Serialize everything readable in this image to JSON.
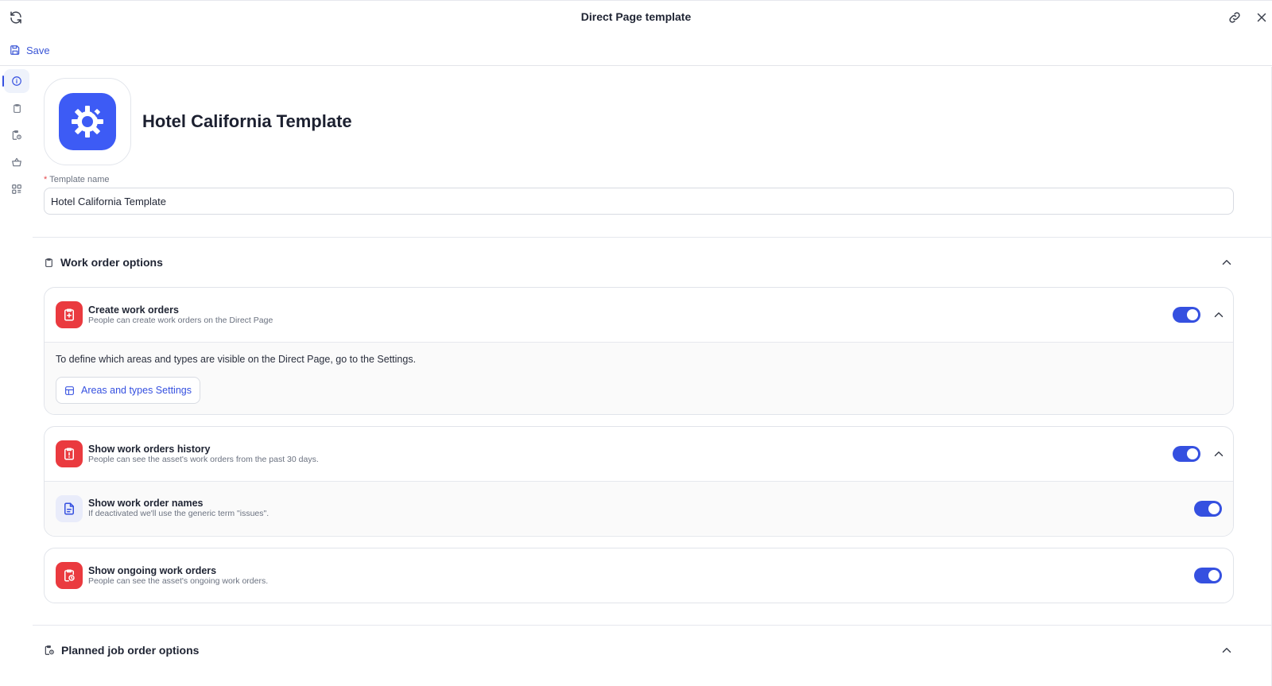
{
  "window": {
    "title": "Direct Page template",
    "refresh_icon": "refresh-icon",
    "link_icon": "link-icon",
    "close_icon": "close-icon"
  },
  "toolbar": {
    "save_label": "Save",
    "save_icon": "save-icon"
  },
  "sidenav": {
    "items": [
      {
        "icon": "info-icon",
        "active": true
      },
      {
        "icon": "clipboard-icon",
        "active": false
      },
      {
        "icon": "clipboard-clock-icon",
        "active": false
      },
      {
        "icon": "basket-icon",
        "active": false
      },
      {
        "icon": "apps-icon",
        "active": false
      }
    ]
  },
  "template": {
    "title": "Hotel California Template",
    "name_label": "Template name",
    "name_value": "Hotel California Template",
    "brand_color": "#3d5bf5"
  },
  "sections": {
    "work_orders": {
      "title": "Work order options",
      "create": {
        "title": "Create work orders",
        "subtitle": "People can create work orders on the Direct Page",
        "enabled": true,
        "info": "To define which areas and types are visible on the Direct Page, go to the Settings.",
        "settings_button": "Areas and types Settings"
      },
      "history": {
        "title": "Show work orders history",
        "subtitle": "People can see the asset's work orders from the past 30 days.",
        "enabled": true,
        "names": {
          "title": "Show work order names",
          "subtitle": "If deactivated we'll use the generic term \"issues\".",
          "enabled": true
        }
      },
      "ongoing": {
        "title": "Show ongoing work orders",
        "subtitle": "People can see the asset's ongoing work orders.",
        "enabled": true
      }
    },
    "planned": {
      "title": "Planned job order options"
    }
  },
  "colors": {
    "accent": "#3550e0",
    "danger": "#ea3a3f"
  }
}
